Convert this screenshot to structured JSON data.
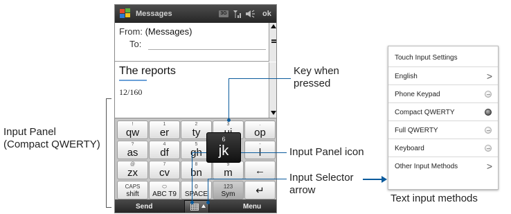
{
  "phone": {
    "title": "Messages",
    "status_3g": "3G",
    "ok": "ok",
    "from_label": "From:",
    "from_value": "(Messages)",
    "to_label": "To:",
    "subject": "The reports",
    "char_count": "12/160",
    "keyboard": {
      "row1": [
        {
          "small": "!",
          "large": "qw"
        },
        {
          "small": "1",
          "large": "er"
        },
        {
          "small": "2",
          "large": "ty"
        },
        {
          "small": "3",
          "large": "ui"
        },
        {
          "small": ".",
          "large": "op"
        }
      ],
      "row2": [
        {
          "small": "?",
          "large": "as"
        },
        {
          "small": "4",
          "large": "df"
        },
        {
          "small": "5",
          "large": "gh"
        },
        {
          "small": "",
          "large": ""
        },
        {
          "small": "-",
          "large": "l"
        }
      ],
      "pressed": {
        "small": "6",
        "large": "jk"
      },
      "row3": [
        {
          "small": "@",
          "large": "zx"
        },
        {
          "small": "7",
          "large": "cv"
        },
        {
          "small": "8",
          "large": "bn"
        },
        {
          "small": "9",
          "large": "m"
        },
        {
          "small": "",
          "large": "←"
        }
      ],
      "row4": [
        {
          "small": "CAPS",
          "large": "shift"
        },
        {
          "small": "",
          "large": "ABC T9"
        },
        {
          "small": "0",
          "large": "SPACE"
        },
        {
          "small": "123",
          "large": "Sym"
        },
        {
          "small": "",
          "large": "↵"
        }
      ]
    },
    "softkey_left": "Send",
    "softkey_right": "Menu"
  },
  "callouts": {
    "key_when_pressed": [
      "Key when",
      "pressed"
    ],
    "input_panel": [
      "Input Panel",
      "(Compact QWERTY)"
    ],
    "input_panel_icon": "Input Panel icon",
    "input_selector_arrow": [
      "Input Selector",
      "arrow"
    ],
    "text_input_methods": "Text input methods"
  },
  "input_menu": {
    "items": [
      {
        "label": "Touch Input Settings",
        "control": "none"
      },
      {
        "label": "English",
        "control": "chevron"
      },
      {
        "label": "Phone Keypad",
        "control": "radio"
      },
      {
        "label": "Compact QWERTY",
        "control": "radio-selected"
      },
      {
        "label": "Full QWERTY",
        "control": "radio"
      },
      {
        "label": "Keyboard",
        "control": "radio"
      },
      {
        "label": "Other Input Methods",
        "control": "chevron"
      }
    ],
    "chevron_glyph": ">"
  },
  "colors": {
    "callout_line": "#0a5a9c",
    "titlebar": "#333333",
    "keyboard_bg": "#c6c6c6"
  }
}
